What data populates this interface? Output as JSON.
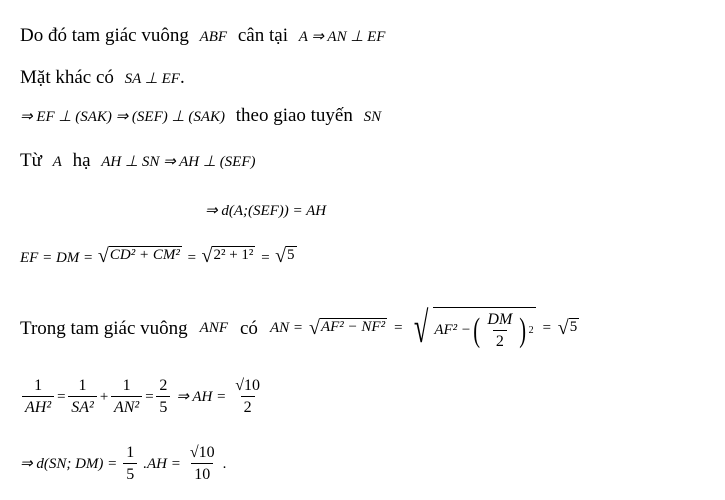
{
  "document": {
    "lines": [
      {
        "text_before": "Do đó tam giác vuông",
        "math1": "ABF",
        "text_mid": "cân tại",
        "math2": "A ⇒ AN ⊥ EF"
      },
      {
        "text_before": "Mặt khác có",
        "math1": "SA ⊥ EF",
        "tail": "."
      },
      {
        "math1": "⇒ EF ⊥ (SAK) ⇒ (SEF) ⊥ (SAK)",
        "text_mid": "theo giao tuyến",
        "math2": "SN"
      },
      {
        "text_before": "Từ",
        "math1": "A",
        "text_mid": "hạ",
        "math2": "AH ⊥ SN ⇒ AH ⊥ (SEF)"
      },
      {
        "math1": "⇒ d(A;(SEF)) = AH"
      },
      {
        "lhs": "EF = DM =",
        "sqrt1": "CD² + CM²",
        "eq": "=",
        "sqrt2": "2² + 1²",
        "eq2": "=",
        "sqrt3": "5"
      },
      {
        "text_before": "Trong tam giác vuông",
        "math1": "ANF",
        "text_mid": "có",
        "lhs": "AN =",
        "sqrt1": "AF² − NF²",
        "eq": "=",
        "sqrt2_pre": "AF² −",
        "frac_num": "DM",
        "frac_den": "2",
        "exp": "2",
        "eq2": "=",
        "sqrt3": "5"
      },
      {
        "f1_num": "1",
        "f1_den": "AH²",
        "eq": "=",
        "f2_num": "1",
        "f2_den": "SA²",
        "plus": "+",
        "f3_num": "1",
        "f3_den": "AN²",
        "eq2": "=",
        "f4_num": "2",
        "f4_den": "5",
        "impl": "⇒ AH =",
        "f5_num": "√10",
        "f5_den": "2"
      },
      {
        "lhs": "⇒ d(SN; DM) =",
        "f1_num": "1",
        "f1_den": "5",
        "mid": ".AH =",
        "f2_num": "√10",
        "f2_den": "10",
        "tail": "."
      }
    ]
  }
}
